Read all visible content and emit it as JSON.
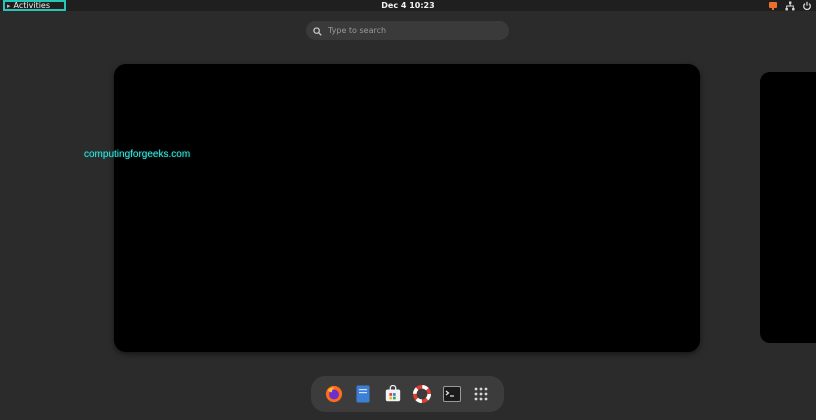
{
  "topbar": {
    "activities_label": "Activities",
    "clock": "Dec 4  10:23",
    "tray_icons": [
      "indicator-icon",
      "network-icon",
      "power-icon"
    ]
  },
  "search": {
    "placeholder": "Type to search"
  },
  "watermark": "computingforgeeks.com",
  "dock": {
    "items": [
      "firefox-icon",
      "files-icon",
      "software-store-icon",
      "help-icon",
      "terminal-icon",
      "show-apps-icon"
    ]
  },
  "colors": {
    "panel": "#1f1f1f",
    "background": "#2b2b2b",
    "highlight": "#26c6b6",
    "watermark": "#3fe9e4"
  }
}
